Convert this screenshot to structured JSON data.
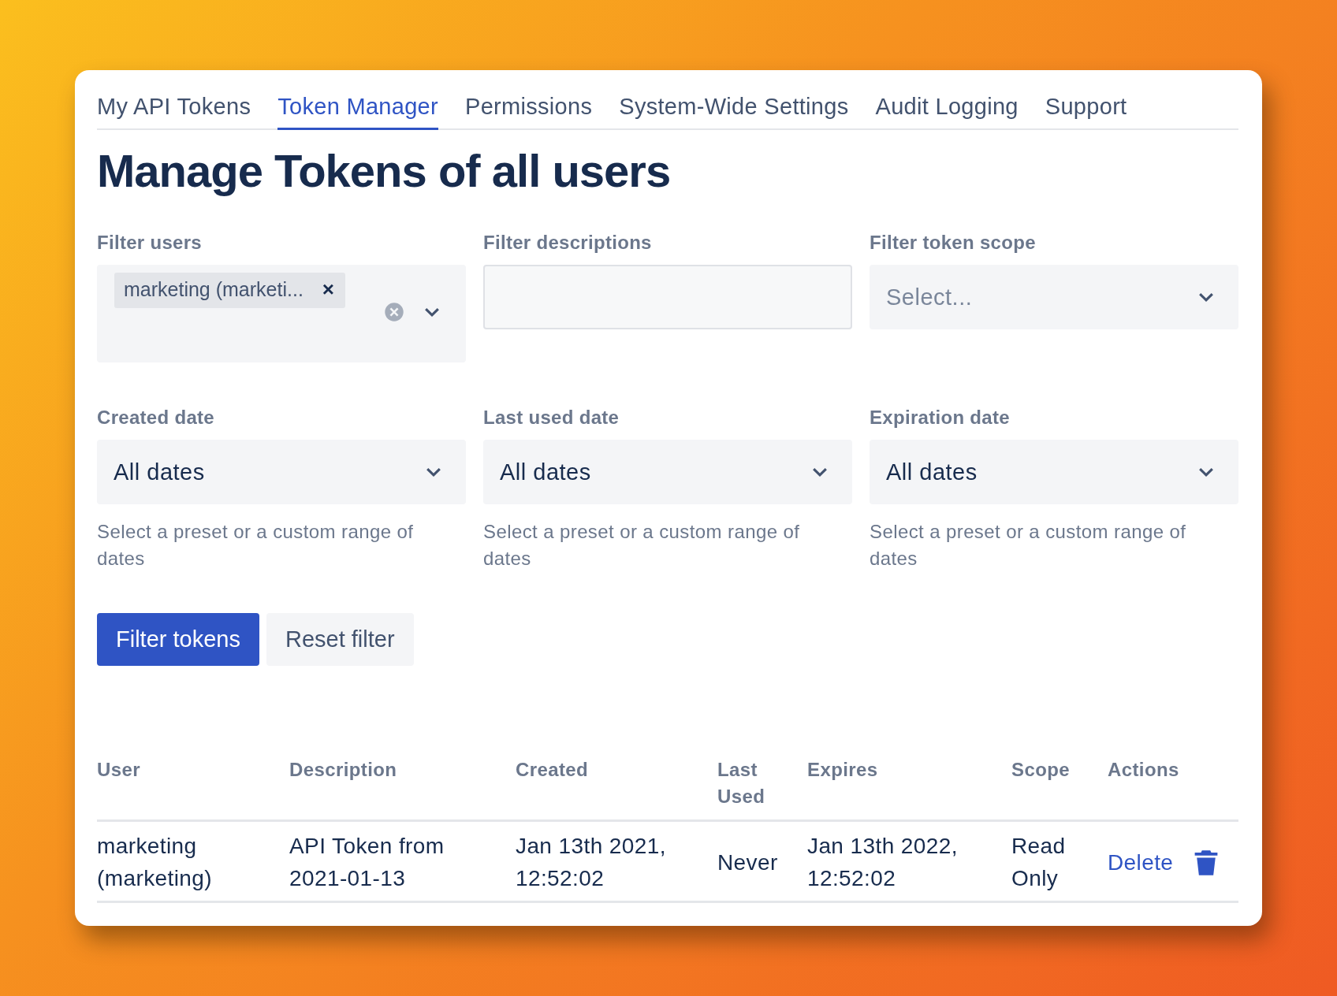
{
  "tabs": [
    {
      "label": "My API Tokens",
      "selected": false
    },
    {
      "label": "Token Manager",
      "selected": true
    },
    {
      "label": "Permissions",
      "selected": false
    },
    {
      "label": "System-Wide Settings",
      "selected": false
    },
    {
      "label": "Audit Logging",
      "selected": false
    },
    {
      "label": "Support",
      "selected": false
    }
  ],
  "heading": "Manage Tokens of all users",
  "filters": [
    {
      "kind": "multiselect",
      "label": "Filter users",
      "tag": "marketing (marketi...",
      "tag_remove": "×"
    },
    {
      "kind": "text",
      "label": "Filter descriptions"
    },
    {
      "kind": "select",
      "label": "Filter token scope",
      "placeholder": "Select..."
    }
  ],
  "date_filters": [
    {
      "label": "Created date",
      "value": "All dates",
      "help": "Select a preset or a custom range of dates"
    },
    {
      "label": "Last used date",
      "value": "All dates",
      "help": "Select a preset or a custom range of dates"
    },
    {
      "label": "Expiration date",
      "value": "All dates",
      "help": "Select a preset or a custom range of dates"
    }
  ],
  "buttons": [
    {
      "kind": "primary",
      "label": "Filter tokens"
    },
    {
      "kind": "secondary",
      "label": "Reset filter"
    }
  ],
  "table": {
    "columns": [
      "User",
      "Description",
      "Created",
      "Last Used",
      "Expires",
      "Scope",
      "Actions"
    ],
    "rows": [
      {
        "cells": [
          "marketing (marketing)",
          "API Token from 2021-01-13",
          "Jan 13th 2021, 12:52:02",
          "Never",
          "Jan 13th 2022, 12:52:02",
          "Read Only"
        ],
        "action": "Delete"
      }
    ]
  }
}
